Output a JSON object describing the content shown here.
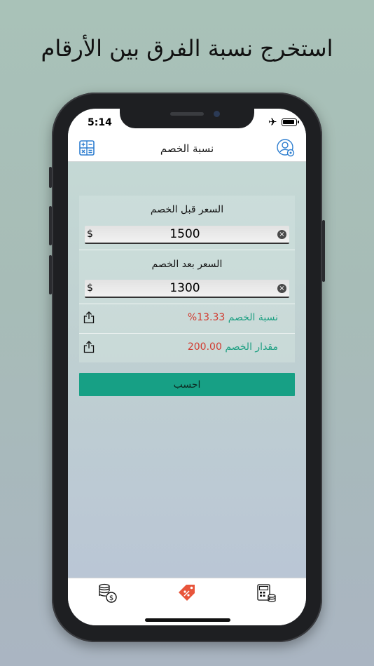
{
  "headline": "استخرج نسبة الفرق بين الأرقام",
  "status": {
    "time": "5:14",
    "airplane_glyph": "✈"
  },
  "nav": {
    "title": "نسبة الخصم"
  },
  "form": {
    "price_before_label": "السعر قبل الخصم",
    "price_before_value": "1500",
    "price_after_label": "السعر بعد الخصم",
    "price_after_value": "1300",
    "currency": "$",
    "clear_glyph": "×"
  },
  "results": {
    "percent_label": "نسبة الخصم",
    "percent_value": "13.33%",
    "amount_label": "مقدار الخصم",
    "amount_value": "200.00"
  },
  "calculate_label": "احسب",
  "icons": {
    "calculator": "calculator-icon",
    "user_settings": "user-settings-icon",
    "share": "share-icon",
    "coins": "coins-dollar-icon",
    "discount_tag": "discount-tag-icon",
    "calculator_money": "calculator-money-icon"
  },
  "colors": {
    "accent": "#17a085",
    "label_green": "#1fa083",
    "value_red": "#d13b30",
    "icon_blue": "#2f7fd0",
    "tag_orange": "#e8553b"
  }
}
